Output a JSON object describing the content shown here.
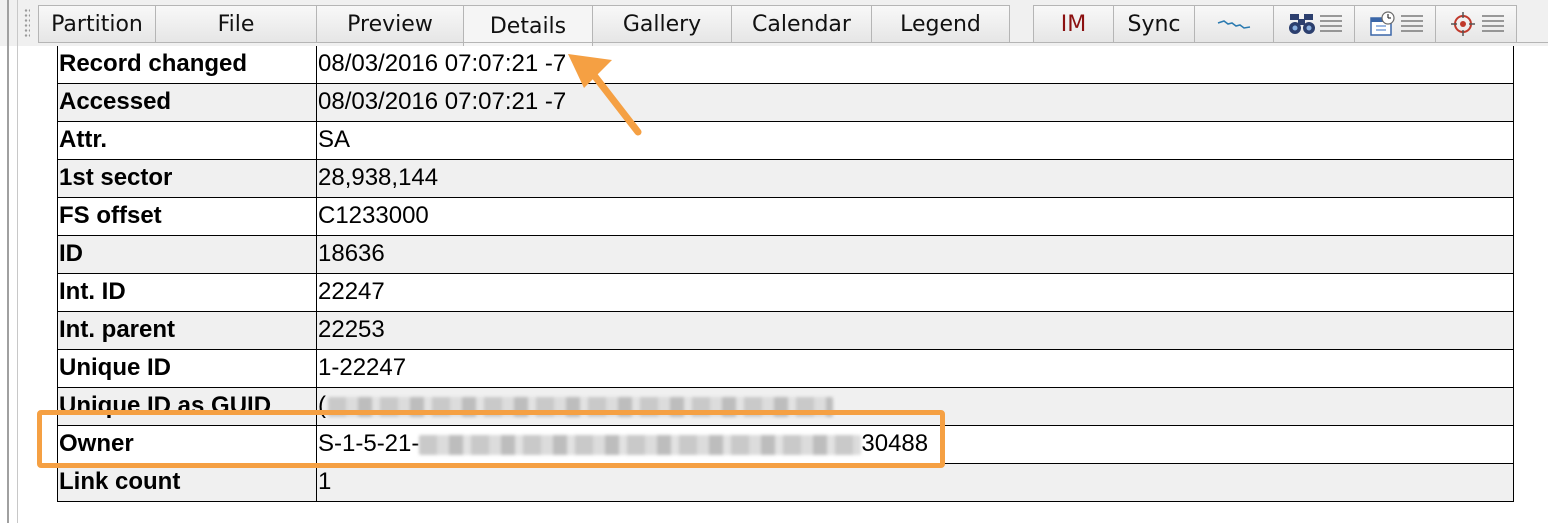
{
  "tabs": [
    {
      "label": "Partition",
      "active": false
    },
    {
      "label": "File",
      "active": false
    },
    {
      "label": "Preview",
      "active": false
    },
    {
      "label": "Details",
      "active": true
    },
    {
      "label": "Gallery",
      "active": false
    },
    {
      "label": "Calendar",
      "active": false
    },
    {
      "label": "Legend",
      "active": false
    },
    {
      "label": "IM",
      "active": false
    },
    {
      "label": "Sync",
      "active": false
    }
  ],
  "icon_tabs": [
    "timeline-wave-icon",
    "binoculars-list-icon",
    "calendar-list-icon",
    "target-list-icon"
  ],
  "details": {
    "rows": [
      {
        "key": "Record changed",
        "value": "08/03/2016  07:07:21  -7"
      },
      {
        "key": "Accessed",
        "value": "08/03/2016  07:07:21  -7"
      },
      {
        "key": "Attr.",
        "value": "SA"
      },
      {
        "key": "1st sector",
        "value": "28,938,144"
      },
      {
        "key": "FS offset",
        "value": "C1233000"
      },
      {
        "key": "ID",
        "value": "18636"
      },
      {
        "key": "Int. ID",
        "value": "22247"
      },
      {
        "key": "Int. parent",
        "value": "22253"
      },
      {
        "key": "Unique ID",
        "value": "1-22247"
      },
      {
        "key": "Unique ID as GUID",
        "value": "("
      },
      {
        "key": "Owner",
        "value_prefix": "S-1-5-21-",
        "value_suffix": "30488"
      },
      {
        "key": "Link count",
        "value": "1"
      }
    ]
  },
  "colors": {
    "annotation": "#f5a043",
    "im_tab": "#8b1010",
    "row_alt": "#f0f0f0"
  }
}
